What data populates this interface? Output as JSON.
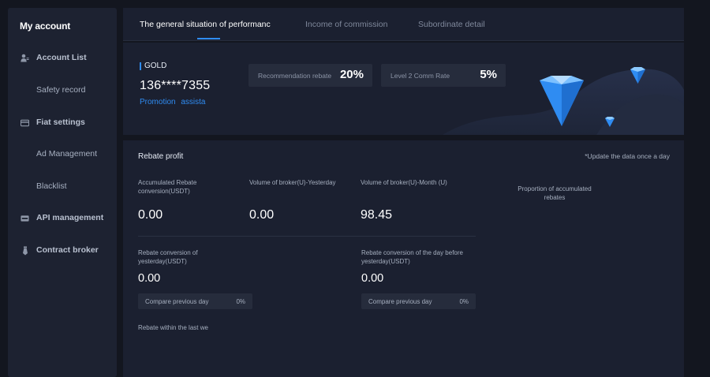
{
  "sidebar": {
    "title": "My account",
    "items": [
      {
        "label": "Account List",
        "icon": "user-icon"
      },
      {
        "label": "Safety record",
        "icon": ""
      },
      {
        "label": "Fiat settings",
        "icon": "card-icon"
      },
      {
        "label": "Ad Management",
        "icon": ""
      },
      {
        "label": "Blacklist",
        "icon": ""
      },
      {
        "label": "API management",
        "icon": "api-icon"
      },
      {
        "label": "Contract broker",
        "icon": "tie-icon"
      }
    ]
  },
  "tabs": [
    {
      "label": "The general situation of  performanc",
      "active": true
    },
    {
      "label": "Income of commission",
      "active": false
    },
    {
      "label": "Subordinate detail",
      "active": false
    }
  ],
  "profile": {
    "level": "GOLD",
    "account": "136****7355",
    "promotion": "Promotion  assista"
  },
  "rates": {
    "recommendation_label": "Recommendation rebate",
    "recommendation_value": "20%",
    "level2_label": "Level 2 Comm Rate",
    "level2_value": "5%"
  },
  "rebate": {
    "title": "Rebate profit",
    "note": "*Update the data once a day",
    "accumulated_label": "Accumulated Rebate conversion(USDT)",
    "accumulated_value": "0.00",
    "yesterday_volume_label": "Volume of broker(U)-Yesterday",
    "yesterday_volume_value": "0.00",
    "month_volume_label": "Volume of broker(U)-Month (U)",
    "month_volume_value": "98.45",
    "yesterday_conv_label": "Rebate conversion of yesterday(USDT)",
    "yesterday_conv_value": "0.00",
    "daybefore_conv_label": "Rebate conversion  of the day before yesterday(USDT)",
    "daybefore_conv_value": "0.00",
    "compare_label": "Compare previous day",
    "compare_value_1": "0%",
    "compare_value_2": "0%",
    "proportion_label": "Proportion of accumulated  rebates",
    "last_we_label": "Rebate within the last we"
  },
  "colors": {
    "accent": "#2f8cf2",
    "panel": "#1b2030",
    "sidebar": "#1d2231",
    "background": "#13161f"
  }
}
